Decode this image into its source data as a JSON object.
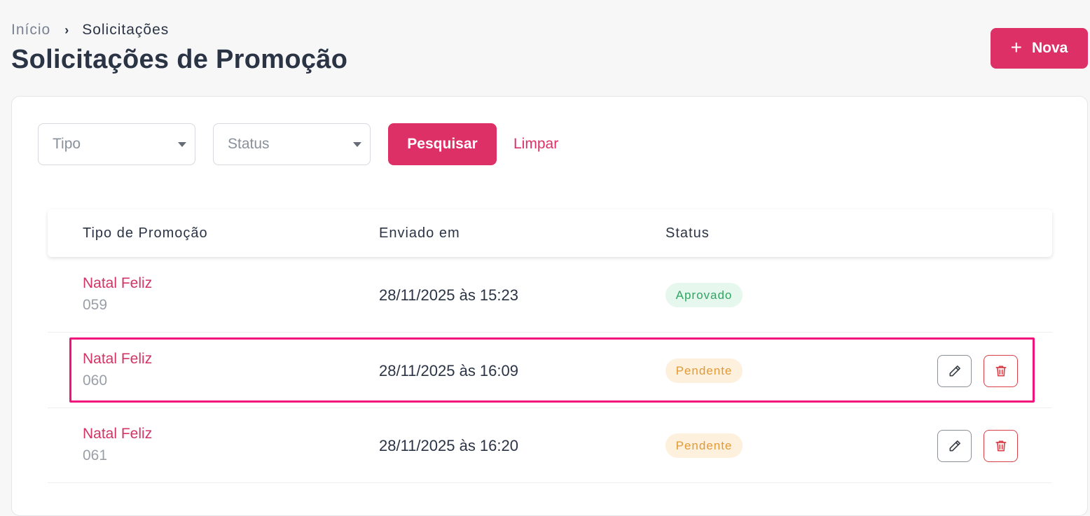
{
  "breadcrumb": {
    "home": "Início",
    "separator": "›",
    "current": "Solicitações"
  },
  "page": {
    "title": "Solicitações de Promoção"
  },
  "actions": {
    "new_icon": "plus-icon",
    "new_label": "Nova"
  },
  "filters": {
    "type_placeholder": "Tipo",
    "status_placeholder": "Status",
    "search_label": "Pesquisar",
    "clear_label": "Limpar"
  },
  "table": {
    "columns": [
      "Tipo de Promoção",
      "Enviado em",
      "Status"
    ],
    "rows": [
      {
        "name": "Natal Feliz",
        "number": "059",
        "sent_at": "28/11/2025 às 15:23",
        "status": "Aprovado",
        "status_kind": "approved",
        "actions": false
      },
      {
        "name": "Natal Feliz",
        "number": "060",
        "sent_at": "28/11/2025 às 16:09",
        "status": "Pendente",
        "status_kind": "pending",
        "actions": true
      },
      {
        "name": "Natal Feliz",
        "number": "061",
        "sent_at": "28/11/2025 às 16:20",
        "status": "Pendente",
        "status_kind": "pending",
        "actions": true
      }
    ]
  },
  "colors": {
    "accent": "#dc3066",
    "approved_bg": "#e6f8ee",
    "approved_text": "#2fa561",
    "pending_bg": "#fdf0dc",
    "pending_text": "#e19a3a",
    "highlight": "#f2127c"
  },
  "icons": {
    "edit": "pencil-icon",
    "delete": "trash-icon",
    "dropdown": "caret-down-icon"
  }
}
